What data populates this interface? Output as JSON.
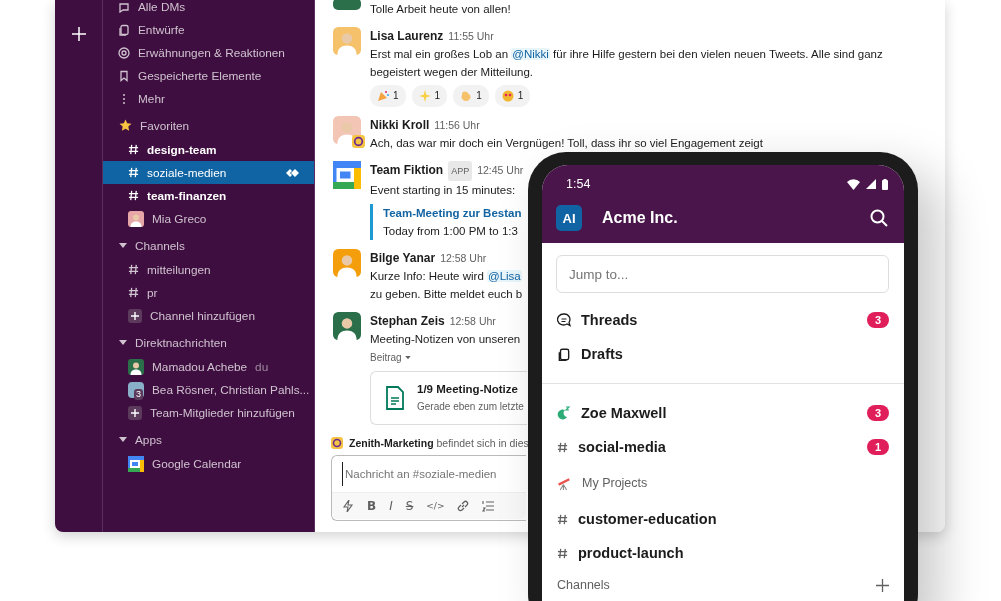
{
  "sidebar": {
    "nav": [
      {
        "kind": "dms",
        "label": "Alle DMs"
      },
      {
        "kind": "drafts",
        "label": "Entwürfe"
      },
      {
        "kind": "mentions",
        "label": "Erwähnungen & Reaktionen"
      },
      {
        "kind": "saved",
        "label": "Gespeicherte Elemente"
      },
      {
        "kind": "more",
        "label": "Mehr"
      }
    ],
    "sections": [
      {
        "kind": "starred",
        "title": "Favoriten",
        "items": [
          {
            "kind": "channel",
            "label": "design-team",
            "unread": true,
            "selected": false
          },
          {
            "kind": "channel",
            "label": "soziale-medien",
            "unread": false,
            "selected": true
          },
          {
            "kind": "channel",
            "label": "team-finanzen",
            "unread": true,
            "selected": false
          },
          {
            "kind": "person",
            "label": "Mia Greco",
            "unread": false,
            "selected": false
          }
        ]
      },
      {
        "kind": "collapsible",
        "title": "Channels",
        "items": [
          {
            "kind": "channel",
            "label": "mitteilungen",
            "unread": false,
            "selected": false
          },
          {
            "kind": "channel",
            "label": "pr",
            "unread": false,
            "selected": false
          },
          {
            "kind": "add",
            "label": "Channel hinzufügen",
            "unread": false,
            "selected": false
          }
        ]
      },
      {
        "kind": "collapsible",
        "title": "Direktnachrichten",
        "items": [
          {
            "kind": "person",
            "label": "Mamadou Achebe",
            "suffix": "du",
            "unread": false,
            "selected": false
          },
          {
            "kind": "group",
            "label": "Bea Rösner, Christian Pahls...",
            "count": "3",
            "unread": false,
            "selected": false
          },
          {
            "kind": "add",
            "label": "Team-Mitglieder hinzufügen",
            "unread": false,
            "selected": false
          }
        ]
      },
      {
        "kind": "collapsible",
        "title": "Apps",
        "items": [
          {
            "kind": "app",
            "label": "Google Calendar",
            "unread": false,
            "selected": false
          }
        ]
      }
    ]
  },
  "messages": [
    {
      "kind": "continued",
      "lines": [
        [
          {
            "kind": "text",
            "text": "Tolle Arbeit heute von allen!"
          }
        ]
      ]
    },
    {
      "kind": "person",
      "author": "Lisa Laurenz",
      "time": "11:55 Uhr",
      "lines": [
        [
          {
            "kind": "text",
            "text": "Erst mal ein großes Lob an "
          },
          {
            "kind": "mention",
            "text": "@Nikki"
          },
          {
            "kind": "text",
            "text": " für ihre Hilfe gestern bei den vielen neuen Tweets. Alle sind ganz"
          }
        ],
        [
          {
            "kind": "text",
            "text": "begeistert wegen der Mitteilung."
          }
        ]
      ],
      "reactions": [
        {
          "kind": "party",
          "count": "1"
        },
        {
          "kind": "sparkles",
          "count": "1"
        },
        {
          "kind": "clap",
          "count": "1"
        },
        {
          "kind": "hearts",
          "count": "1"
        }
      ]
    },
    {
      "kind": "person",
      "author": "Nikki Kroll",
      "time": "11:56 Uhr",
      "org_badge": true,
      "lines": [
        [
          {
            "kind": "text",
            "text": "Ach, das war mir doch ein Vergnügen! Toll, dass ihr so viel Engagement zeigt"
          }
        ]
      ]
    },
    {
      "kind": "app",
      "author": "Team Fiktion",
      "tag": "APP",
      "time": "12:45 Uhr",
      "lines": [
        [
          {
            "kind": "text",
            "text": "Event starting in 15 minutes:"
          }
        ]
      ],
      "quote": {
        "title": "Team-Meeting zur Bestan",
        "text": "Today from 1:00 PM to 1:3"
      }
    },
    {
      "kind": "person",
      "author": "Bilge Yanar",
      "time": "12:58 Uhr",
      "lines": [
        [
          {
            "kind": "text",
            "text": "Kurze Info: Heute wird "
          },
          {
            "kind": "mention",
            "text": "@Lisa"
          }
        ],
        [
          {
            "kind": "text",
            "text": "zu geben. Bitte meldet euch b"
          }
        ]
      ]
    },
    {
      "kind": "person",
      "author": "Stephan Zeis",
      "time": "12:58 Uhr",
      "lines": [
        [
          {
            "kind": "text",
            "text": "Meeting-Notizen von unseren"
          }
        ]
      ],
      "post_label": "Beitrag",
      "file": {
        "title": "1/9 Meeting-Notize",
        "subtitle": "Gerade eben zum letzte"
      }
    }
  ],
  "banner": {
    "name": "Zenith-Marketing",
    "text": "befindet sich in dies"
  },
  "composer": {
    "placeholder": "Nachricht an #soziale-medien",
    "tools": [
      {
        "kind": "bolt"
      },
      {
        "kind": "bold",
        "label": "B"
      },
      {
        "kind": "italic",
        "label": "I"
      },
      {
        "kind": "strike",
        "label": "S"
      },
      {
        "kind": "code",
        "label": "</>"
      },
      {
        "kind": "link"
      },
      {
        "kind": "list"
      }
    ]
  },
  "phone": {
    "time": "1:54",
    "workspace_initials": "AI",
    "workspace": "Acme Inc.",
    "search": {
      "placeholder": "Jump to..."
    },
    "groups": [
      [
        {
          "kind": "threads",
          "label": "Threads",
          "badge": "3"
        },
        {
          "kind": "drafts",
          "label": "Drafts"
        }
      ],
      [
        {
          "kind": "away",
          "label": "Zoe Maxwell",
          "badge": "3"
        },
        {
          "kind": "channel",
          "label": "social-media",
          "badge": "1"
        },
        {
          "kind": "section",
          "label": "My Projects"
        },
        {
          "kind": "channel",
          "label": "customer-education"
        },
        {
          "kind": "channel",
          "label": "product-launch"
        },
        {
          "kind": "section-add",
          "label": "Channels"
        }
      ]
    ]
  }
}
